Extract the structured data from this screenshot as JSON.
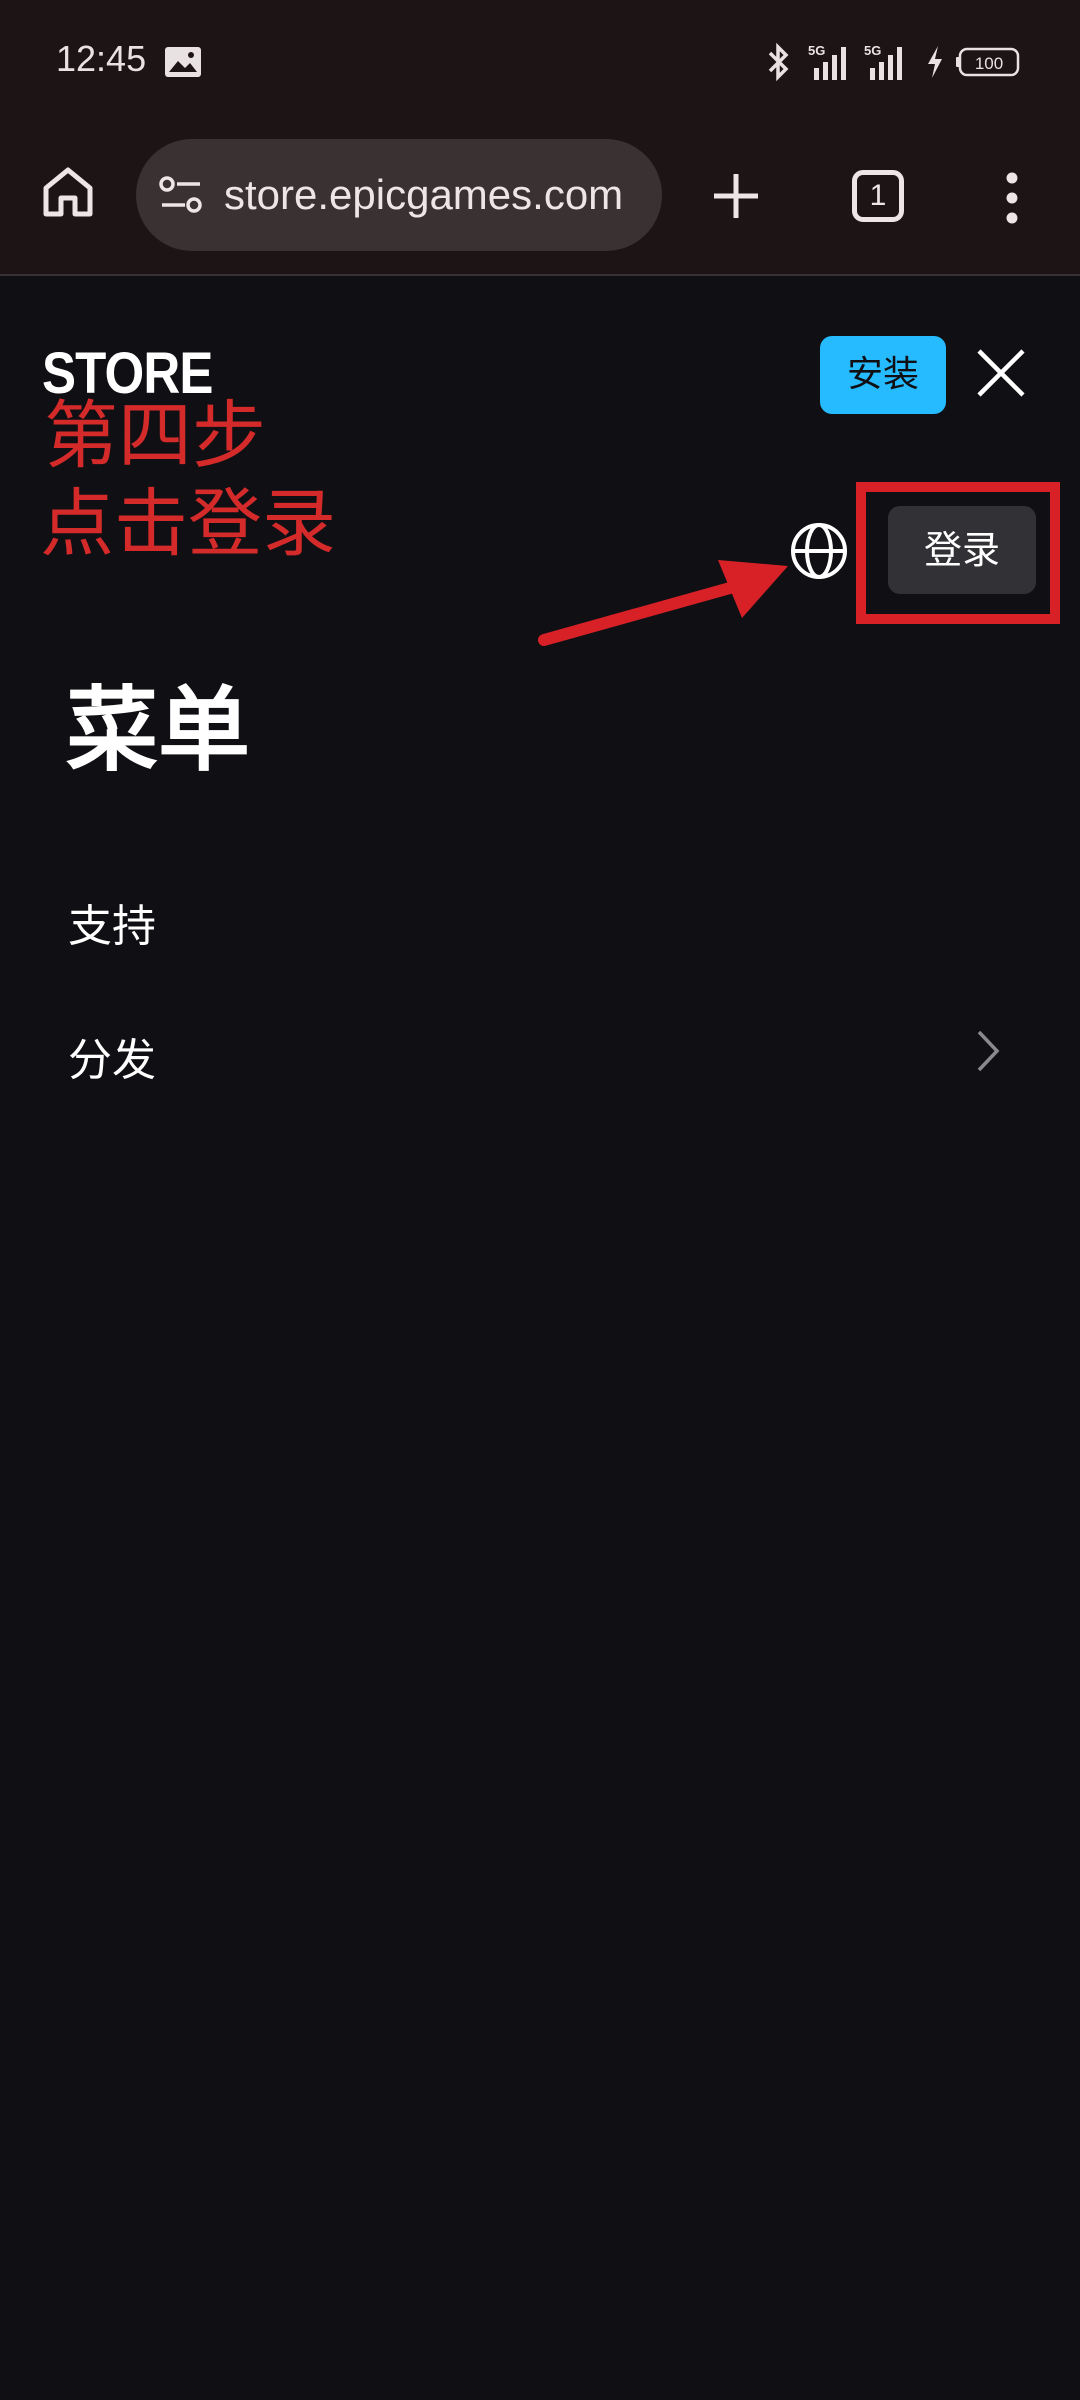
{
  "status_bar": {
    "time": "12:45",
    "battery": "100",
    "icons": [
      "image-icon",
      "bluetooth-icon",
      "signal-5g-icon",
      "signal-5g-icon",
      "charging-icon",
      "battery-icon"
    ]
  },
  "browser": {
    "url": "store.epicgames.com",
    "tab_count": "1"
  },
  "header": {
    "logo": "STORE",
    "install_label": "安装"
  },
  "annotation": {
    "line1": "第四步",
    "line2": "点击登录",
    "color": "#d42a2a"
  },
  "account": {
    "login_label": "登录"
  },
  "menu": {
    "title": "菜单",
    "items": [
      {
        "label": "支持",
        "has_chevron": false
      },
      {
        "label": "分发",
        "has_chevron": true
      }
    ]
  },
  "colors": {
    "background": "#101014",
    "accent": "#26bbff",
    "highlight": "#d82127"
  }
}
